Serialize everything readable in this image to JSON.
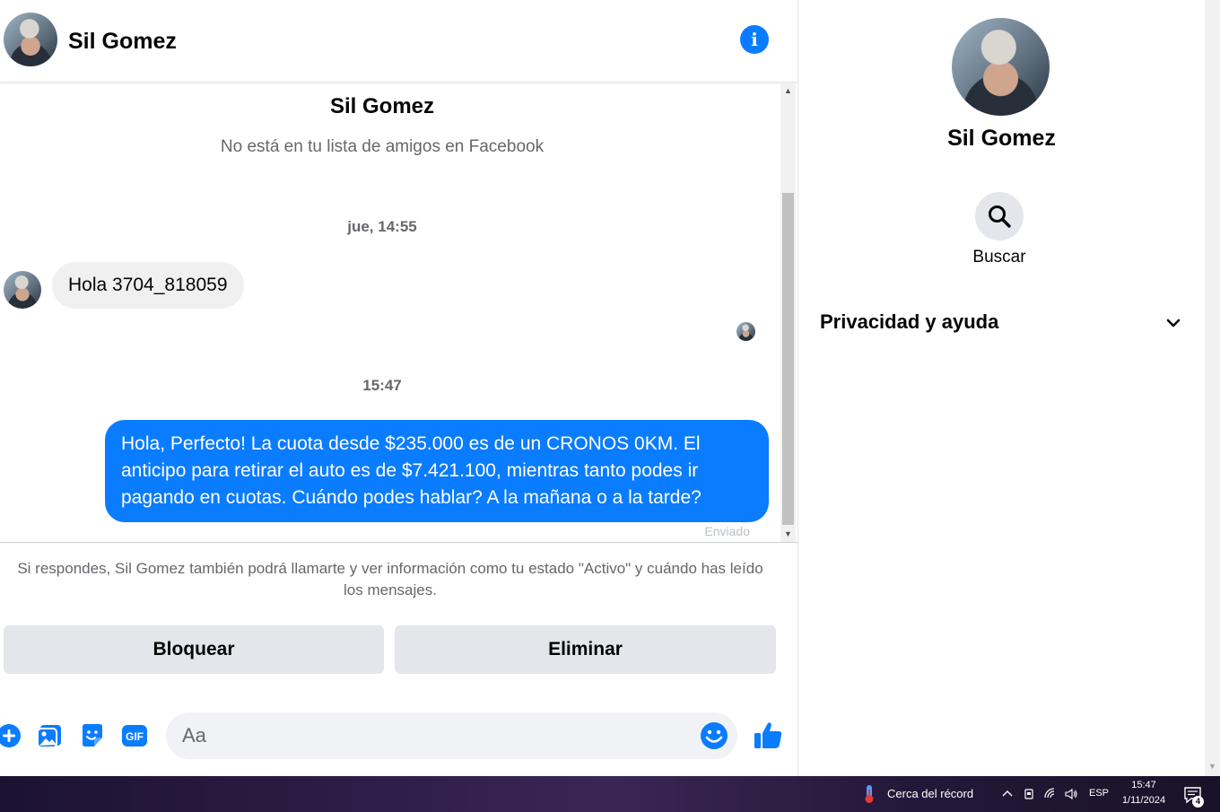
{
  "contact": {
    "name": "Sil Gomez",
    "subtitle": "No está en tu lista de amigos en Facebook"
  },
  "thread": {
    "timestamp_1": "jue, 14:55",
    "incoming_message": "Hola 3704_818059",
    "timestamp_2": "15:47",
    "outgoing_message": "Hola, Perfecto! La cuota desde $235.000 es de un CRONOS 0KM. El anticipo para retirar el auto es de $7.421.100, mientras tanto podes ir pagando en cuotas. Cuándo podes hablar? A la mañana o a la tarde?",
    "sent_status": "Enviado"
  },
  "request_notice": "Si respondes, Sil Gomez también podrá llamarte y ver información como tu estado \"Activo\" y cuándo has leído los mensajes.",
  "actions": {
    "block_label": "Bloquear",
    "delete_label": "Eliminar"
  },
  "composer": {
    "placeholder": "Aa",
    "icons": [
      "plus-icon",
      "photo-icon",
      "sticker-icon",
      "gif-icon",
      "emoji-icon",
      "thumbs-up-icon"
    ],
    "gif_text": "GIF"
  },
  "info_panel": {
    "search_label": "Buscar",
    "privacy_label": "Privacidad y ayuda"
  },
  "taskbar": {
    "weather_text": "Cerca del récord",
    "language": "ESP",
    "time": "15:47",
    "date": "1/11/2024",
    "notification_count": "4"
  },
  "colors": {
    "messenger_blue": "#0a7cff",
    "bubble_gray": "#f0f0f0",
    "button_gray": "#e4e6eb"
  }
}
